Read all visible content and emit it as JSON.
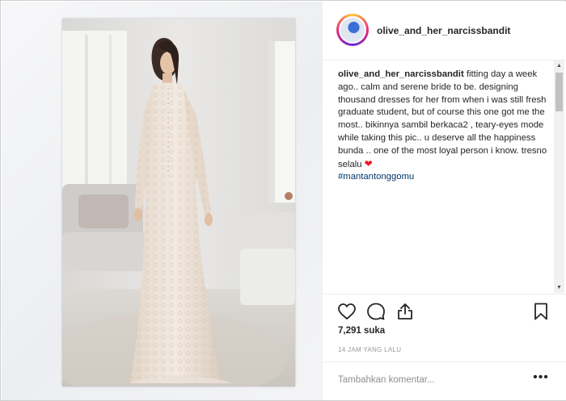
{
  "post": {
    "username": "olive_and_her_narcissbandit",
    "caption_text": "fitting day a week ago.. calm and serene bride to be. designing thousand dresses for her from when i was still fresh graduate student, but of course this one got me the most.. bikinnya sambil berkaca2 , teary-eyes mode while taking this pic.. u deserve all the happiness bunda .. one of the most loyal person i know. tresno selalu",
    "heart_emoji": "❤",
    "hashtag": "#mantantonggomu",
    "likes": "7,291 suka",
    "timestamp": "14 JAM YANG LALU"
  },
  "actions": {
    "like_icon": "heart-outline-icon",
    "comment_icon": "comment-bubble-icon",
    "share_icon": "share-arrow-icon",
    "save_icon": "bookmark-icon"
  },
  "comment": {
    "placeholder": "Tambahkan komentar...",
    "more_label": "•••"
  },
  "colors": {
    "text": "#262626",
    "hashtag": "#003569",
    "muted": "#999999",
    "heart": "#ed1c24"
  }
}
